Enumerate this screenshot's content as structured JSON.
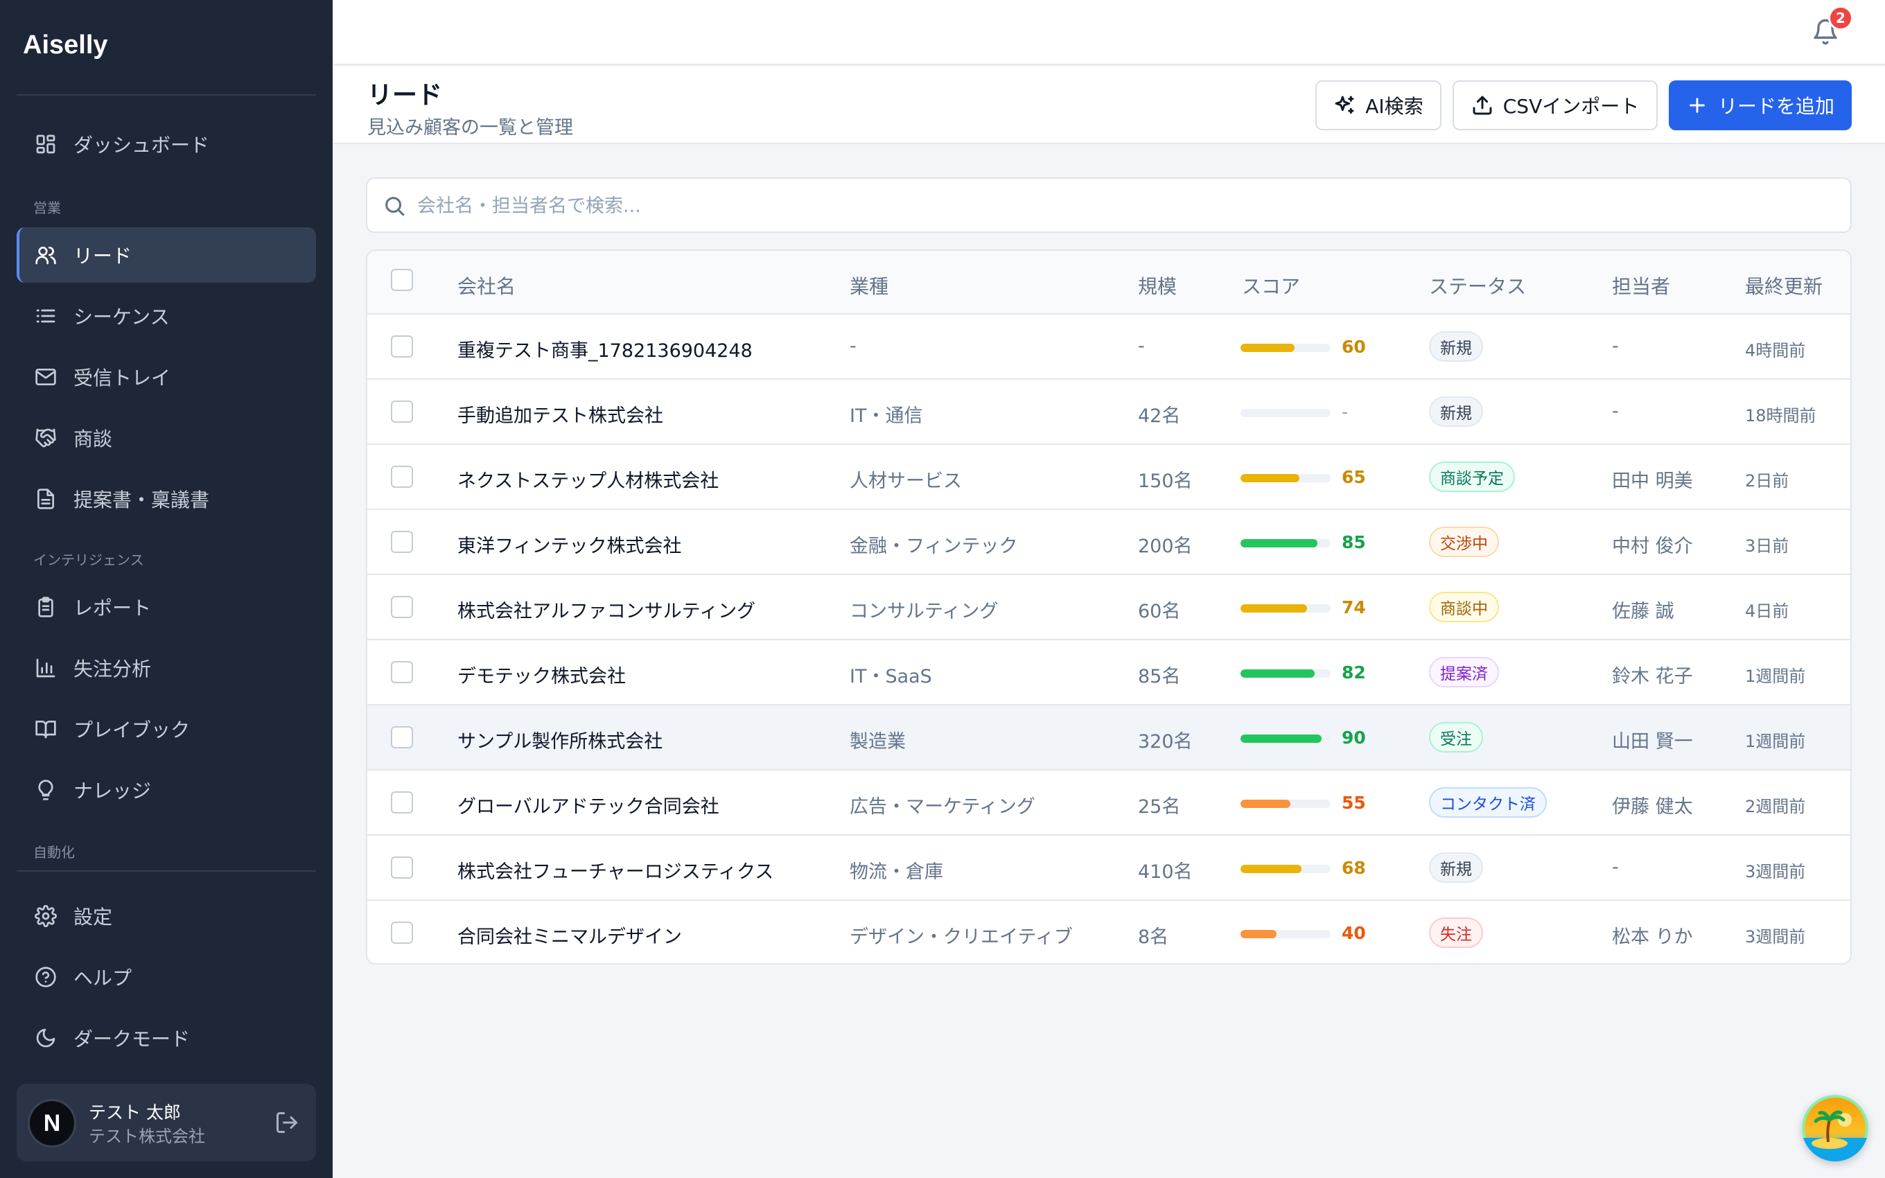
{
  "app": {
    "name": "Aiselly"
  },
  "sidebar": {
    "sections": {
      "sales": "営業",
      "intelligence": "インテリジェンス",
      "automation": "自動化"
    },
    "items": {
      "dashboard": "ダッシュボード",
      "leads": "リード",
      "sequences": "シーケンス",
      "inbox": "受信トレイ",
      "deals": "商談",
      "proposals": "提案書・稟議書",
      "reports": "レポート",
      "lost_analysis": "失注分析",
      "playbook": "プレイブック",
      "knowledge": "ナレッジ",
      "settings": "設定",
      "help": "ヘルプ",
      "dark_mode": "ダークモード"
    },
    "user": {
      "initial": "N",
      "name": "テスト 太郎",
      "company": "テスト株式会社"
    }
  },
  "header": {
    "notification_count": "2"
  },
  "page": {
    "title": "リード",
    "subtitle": "見込み顧客の一覧と管理",
    "actions": {
      "ai_search": "AI検索",
      "csv_import": "CSVインポート",
      "add_lead": "リードを追加"
    }
  },
  "search": {
    "placeholder": "会社名・担当者名で検索..."
  },
  "table": {
    "columns": {
      "company": "会社名",
      "industry": "業種",
      "size": "規模",
      "score": "スコア",
      "status": "ステータス",
      "owner": "担当者",
      "updated": "最終更新"
    },
    "rows": [
      {
        "company": "重複テスト商事_1782136904248",
        "industry": "-",
        "size": "-",
        "score": 60,
        "score_label": "60",
        "status": "新規",
        "owner": "-",
        "updated": "4時間前"
      },
      {
        "company": "手動追加テスト株式会社",
        "industry": "IT・通信",
        "size": "42名",
        "score": 0,
        "score_label": "-",
        "status": "新規",
        "owner": "-",
        "updated": "18時間前"
      },
      {
        "company": "ネクストステップ人材株式会社",
        "industry": "人材サービス",
        "size": "150名",
        "score": 65,
        "score_label": "65",
        "status": "商談予定",
        "owner": "田中 明美",
        "updated": "2日前"
      },
      {
        "company": "東洋フィンテック株式会社",
        "industry": "金融・フィンテック",
        "size": "200名",
        "score": 85,
        "score_label": "85",
        "status": "交渉中",
        "owner": "中村 俊介",
        "updated": "3日前"
      },
      {
        "company": "株式会社アルファコンサルティング",
        "industry": "コンサルティング",
        "size": "60名",
        "score": 74,
        "score_label": "74",
        "status": "商談中",
        "owner": "佐藤 誠",
        "updated": "4日前"
      },
      {
        "company": "デモテック株式会社",
        "industry": "IT・SaaS",
        "size": "85名",
        "score": 82,
        "score_label": "82",
        "status": "提案済",
        "owner": "鈴木 花子",
        "updated": "1週間前"
      },
      {
        "company": "サンプル製作所株式会社",
        "industry": "製造業",
        "size": "320名",
        "score": 90,
        "score_label": "90",
        "status": "受注",
        "owner": "山田 賢一",
        "updated": "1週間前"
      },
      {
        "company": "グローバルアドテック合同会社",
        "industry": "広告・マーケティング",
        "size": "25名",
        "score": 55,
        "score_label": "55",
        "status": "コンタクト済",
        "owner": "伊藤 健太",
        "updated": "2週間前"
      },
      {
        "company": "株式会社フューチャーロジスティクス",
        "industry": "物流・倉庫",
        "size": "410名",
        "score": 68,
        "score_label": "68",
        "status": "新規",
        "owner": "-",
        "updated": "3週間前"
      },
      {
        "company": "合同会社ミニマルデザイン",
        "industry": "デザイン・クリエイティブ",
        "size": "8名",
        "score": 40,
        "score_label": "40",
        "status": "失注",
        "owner": "松本 りか",
        "updated": "3週間前"
      }
    ]
  },
  "colors": {
    "score_high": "#22c55e",
    "score_mid": "#eab308",
    "score_low": "#fb923c",
    "score_text_high": "#16a34a",
    "score_text_mid": "#ca8a04",
    "score_text_low": "#ea580c",
    "status": {
      "新規": {
        "bg": "#f1f5f9",
        "fg": "#334155",
        "border": "#e2e8f0"
      },
      "商談予定": {
        "bg": "#ecfdf5",
        "fg": "#047857",
        "border": "#a7f3d0"
      },
      "交渉中": {
        "bg": "#fff7ed",
        "fg": "#c2410c",
        "border": "#fed7aa"
      },
      "商談中": {
        "bg": "#fefce8",
        "fg": "#a16207",
        "border": "#fde68a"
      },
      "提案済": {
        "bg": "#faf5ff",
        "fg": "#7e22ce",
        "border": "#e9d5ff"
      },
      "受注": {
        "bg": "#ecfdf5",
        "fg": "#047857",
        "border": "#a7f3d0"
      },
      "コンタクト済": {
        "bg": "#eff6ff",
        "fg": "#1d4ed8",
        "border": "#bfdbfe"
      },
      "失注": {
        "bg": "#fef2f2",
        "fg": "#dc2626",
        "border": "#fecaca"
      }
    }
  }
}
